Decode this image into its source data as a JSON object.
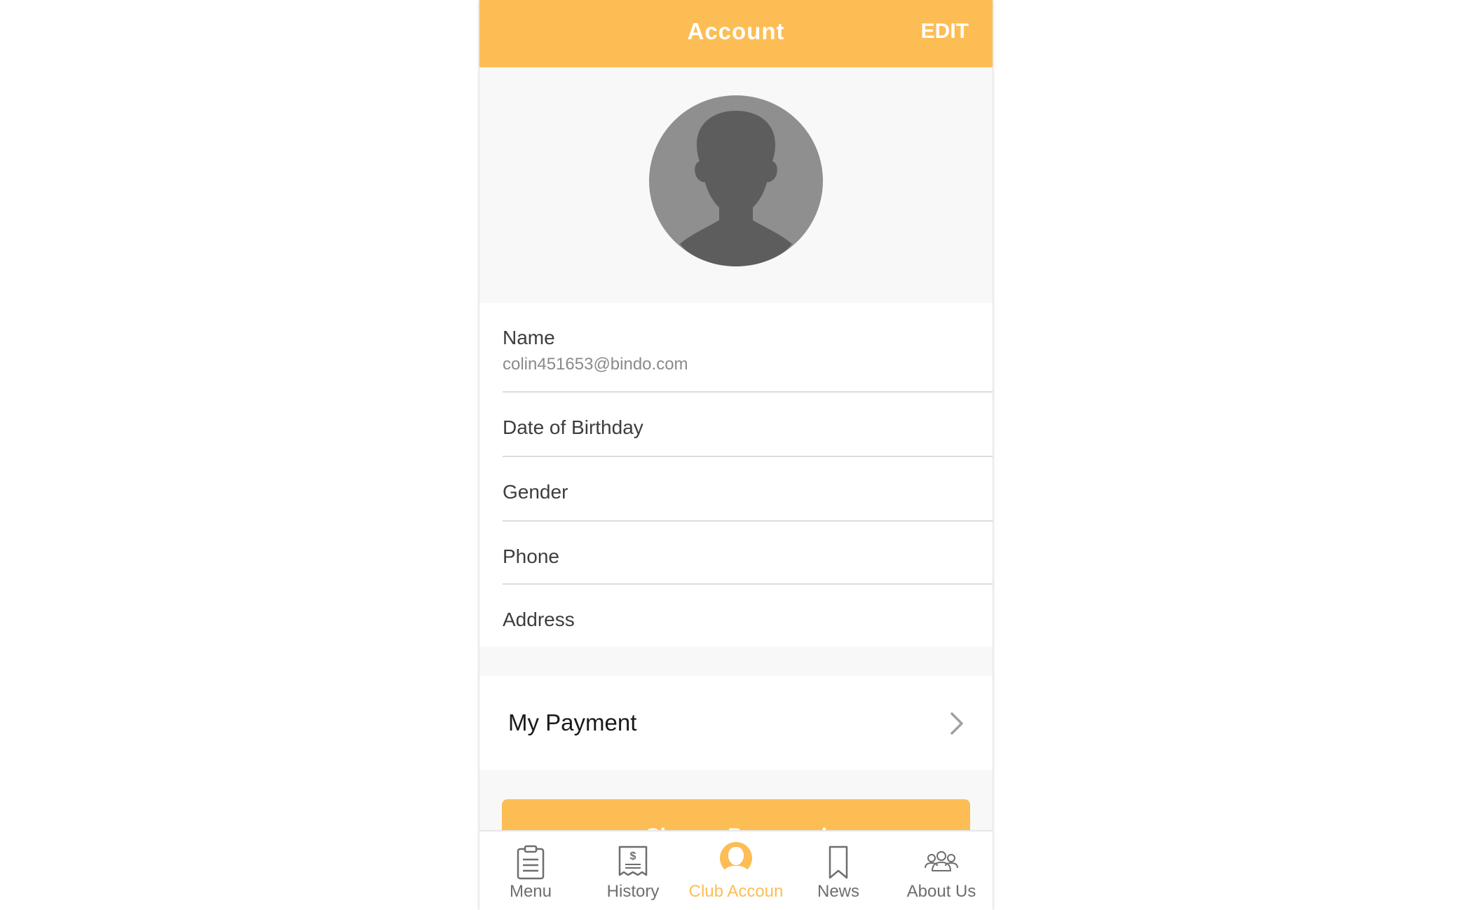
{
  "header": {
    "title": "Account",
    "edit_label": "EDIT"
  },
  "colors": {
    "accent": "#fdbd55",
    "background": "#f8f8f8",
    "avatar_bg": "#8f8f8f",
    "silhouette": "#5d5d5d"
  },
  "profile": {
    "avatar_icon": "person-silhouette-icon",
    "fields": [
      {
        "label": "Name",
        "value": "colin451653@bindo.com"
      },
      {
        "label": "Date of Birthday",
        "value": ""
      },
      {
        "label": "Gender",
        "value": ""
      },
      {
        "label": "Phone",
        "value": ""
      },
      {
        "label": "Address",
        "value": ""
      }
    ]
  },
  "payment": {
    "label": "My Payment",
    "icon": "chevron-right-icon"
  },
  "primary_button": {
    "label": "Change Password"
  },
  "tabbar": {
    "active_index": 2,
    "items": [
      {
        "label": "Menu",
        "icon": "clipboard-icon"
      },
      {
        "label": "History",
        "icon": "receipt-dollar-icon"
      },
      {
        "label": "Club Accoun",
        "icon": "user-circle-icon"
      },
      {
        "label": "News",
        "icon": "bookmark-icon"
      },
      {
        "label": "About Us",
        "icon": "group-icon"
      }
    ]
  }
}
